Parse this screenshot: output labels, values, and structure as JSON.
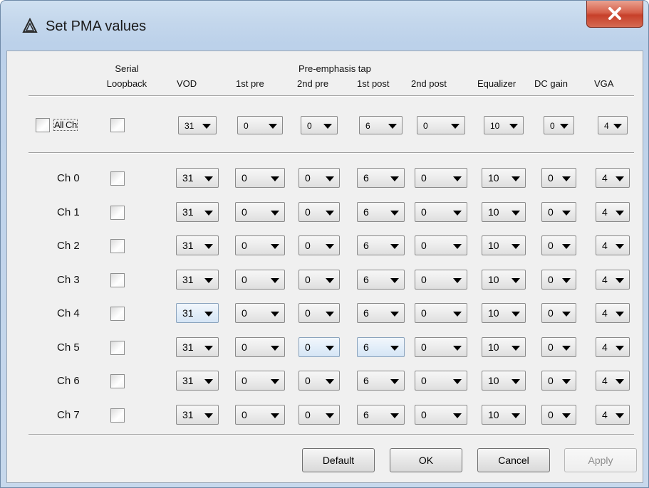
{
  "window": {
    "title": "Set PMA values"
  },
  "headers": {
    "serial": "Serial",
    "loopback": "Loopback",
    "vod": "VOD",
    "pre1": "1st pre",
    "preemph_group": "Pre-emphasis tap",
    "pre2": "2nd pre",
    "post1": "1st post",
    "post2": "2nd post",
    "eq": "Equalizer",
    "dcgain": "DC gain",
    "vga": "VGA"
  },
  "all_row": {
    "label": "All Ch",
    "checked": false,
    "loopback": false,
    "values": {
      "vod": "31",
      "pre1": "0",
      "pre2": "0",
      "post1": "6",
      "post2": "0",
      "eq": "10",
      "dc": "0",
      "vga": "4"
    }
  },
  "channels": [
    {
      "label": "Ch 0",
      "loopback": false,
      "vod": "31",
      "pre1": "0",
      "pre2": "0",
      "post1": "6",
      "post2": "0",
      "eq": "10",
      "dc": "0",
      "vga": "4"
    },
    {
      "label": "Ch 1",
      "loopback": false,
      "vod": "31",
      "pre1": "0",
      "pre2": "0",
      "post1": "6",
      "post2": "0",
      "eq": "10",
      "dc": "0",
      "vga": "4"
    },
    {
      "label": "Ch 2",
      "loopback": false,
      "vod": "31",
      "pre1": "0",
      "pre2": "0",
      "post1": "6",
      "post2": "0",
      "eq": "10",
      "dc": "0",
      "vga": "4"
    },
    {
      "label": "Ch 3",
      "loopback": false,
      "vod": "31",
      "pre1": "0",
      "pre2": "0",
      "post1": "6",
      "post2": "0",
      "eq": "10",
      "dc": "0",
      "vga": "4"
    },
    {
      "label": "Ch 4",
      "loopback": false,
      "vod": "31",
      "pre1": "0",
      "pre2": "0",
      "post1": "6",
      "post2": "0",
      "eq": "10",
      "dc": "0",
      "vga": "4"
    },
    {
      "label": "Ch 5",
      "loopback": false,
      "vod": "31",
      "pre1": "0",
      "pre2": "0",
      "post1": "6",
      "post2": "0",
      "eq": "10",
      "dc": "0",
      "vga": "4"
    },
    {
      "label": "Ch 6",
      "loopback": false,
      "vod": "31",
      "pre1": "0",
      "pre2": "0",
      "post1": "6",
      "post2": "0",
      "eq": "10",
      "dc": "0",
      "vga": "4"
    },
    {
      "label": "Ch 7",
      "loopback": false,
      "vod": "31",
      "pre1": "0",
      "pre2": "0",
      "post1": "6",
      "post2": "0",
      "eq": "10",
      "dc": "0",
      "vga": "4"
    }
  ],
  "buttons": {
    "default": "Default",
    "ok": "OK",
    "cancel": "Cancel",
    "apply": "Apply"
  },
  "icons": {
    "app": "altera-logo-icon",
    "close": "close-icon",
    "dropdown": "chevron-down-icon"
  },
  "colors": {
    "close_button": "#c7402a",
    "dialog_bg": "#f0f0f0",
    "frame": "#c4d7ec"
  }
}
